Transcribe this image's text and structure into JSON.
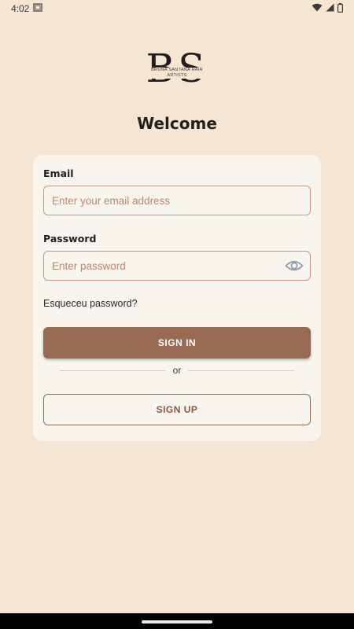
{
  "status_bar": {
    "time": "4:02",
    "icons": [
      "screenshot-icon",
      "wifi-icon",
      "signal-icon",
      "battery-icon"
    ]
  },
  "logo": {
    "letters": "BS",
    "tagline": "BRUNA SANTANA HAIR ARTISTS"
  },
  "welcome": "Welcome",
  "form": {
    "email": {
      "label": "Email",
      "value": "",
      "placeholder": "Enter your email address"
    },
    "password": {
      "label": "Password",
      "value": "",
      "placeholder": "Enter password"
    },
    "forgot_label": "Esqueceu password?",
    "sign_in_label": "SIGN IN",
    "or_label": "or",
    "sign_up_label": "SIGN UP"
  },
  "colors": {
    "background": "#f5e6d3",
    "card": "#f8f4ee",
    "primary": "#9a6b53",
    "input_border": "#c79a80",
    "placeholder": "#b98a6f"
  }
}
